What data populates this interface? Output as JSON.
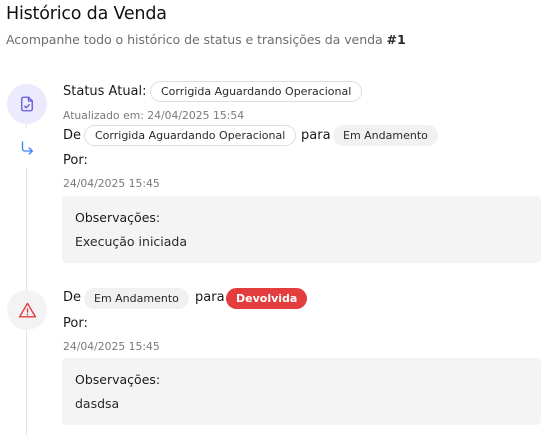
{
  "header": {
    "title": "Histórico da Venda",
    "subtitle": "Acompanhe todo o histórico de status e transições da venda",
    "sale_ref": "#1"
  },
  "current_status": {
    "label": "Status Atual:",
    "value": "Corrigida Aguardando Operacional",
    "updated_label": "Atualizado em: 24/04/2025 15:54",
    "icon": "document-check-icon",
    "icon_bg": "#ebebfd",
    "icon_color": "#6b58d6"
  },
  "transitions": [
    {
      "icon": "arrow-turn-right-icon",
      "icon_color": "#3b82f6",
      "from_label": "De",
      "from": "Corrigida Aguardando Operacional",
      "to_label": "para",
      "to": "Em Andamento",
      "by_label": "Por:",
      "timestamp": "24/04/2025 15:45",
      "notes_label": "Observações:",
      "notes": "Execução iniciada"
    },
    {
      "icon": "warning-triangle-icon",
      "icon_color": "#e33d3d",
      "icon_bg": "#f3f3f3",
      "from_label": "De",
      "from": "Em Andamento",
      "to_label": "para",
      "to": "Devolvida",
      "to_color": "#e33d3d",
      "by_label": "Por:",
      "timestamp": "24/04/2025 15:45",
      "notes_label": "Observações:",
      "notes": "dasdsa"
    }
  ]
}
